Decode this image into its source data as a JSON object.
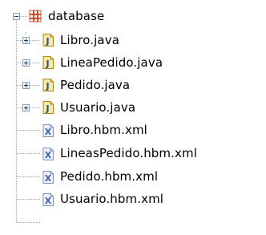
{
  "tree": {
    "package": {
      "label": "database",
      "icon": "package-icon",
      "expanded": true
    },
    "children": [
      {
        "label": "Libro.java",
        "icon": "java-file-icon",
        "expandable": true
      },
      {
        "label": "LineaPedido.java",
        "icon": "java-file-icon",
        "expandable": true
      },
      {
        "label": "Pedido.java",
        "icon": "java-file-icon",
        "expandable": true
      },
      {
        "label": "Usuario.java",
        "icon": "java-file-icon",
        "expandable": true
      },
      {
        "label": "Libro.hbm.xml",
        "icon": "xml-file-icon",
        "expandable": false
      },
      {
        "label": "LineasPedido.hbm.xml",
        "icon": "xml-file-icon",
        "expandable": false
      },
      {
        "label": "Pedido.hbm.xml",
        "icon": "xml-file-icon",
        "expandable": false
      },
      {
        "label": "Usuario.hbm.xml",
        "icon": "xml-file-icon",
        "expandable": false
      }
    ]
  },
  "colors": {
    "tree_line": "#a0a0a0",
    "package_icon": "#c8502d",
    "java_icon": "#e3b51b",
    "xml_icon": "#3f5ea8"
  }
}
